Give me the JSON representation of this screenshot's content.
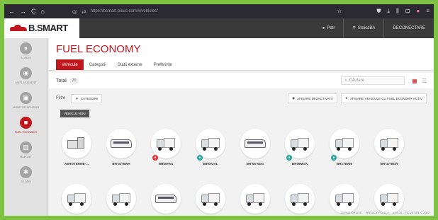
{
  "browser": {
    "url": "https://bsmart.picus.com/#/vehicles/",
    "nav_back": "←",
    "nav_forward": "→",
    "nav_reload": "C",
    "nav_home": "⌂",
    "shield": "◎",
    "lock": "🔒",
    "perm": "⇄",
    "star": "☆",
    "icons_right": [
      "⛊",
      "⤓",
      "⫼",
      "⊡",
      "●",
      "≡"
    ]
  },
  "header": {
    "brand": "B.SMART",
    "user_label": "Petr",
    "company_label": "StoicaBA",
    "logout_label": "DECONECTARE"
  },
  "sidebar": {
    "items": [
      {
        "label": "ȘOFERI",
        "icon": "user"
      },
      {
        "label": "AMPLASAMENT",
        "icon": "pin"
      },
      {
        "label": "MONITOR SENZORI",
        "icon": "sensor"
      },
      {
        "label": "FUEL ECONOMY",
        "icon": "truck",
        "active": true
      },
      {
        "label": "RAPORT",
        "icon": "chart"
      },
      {
        "label": "SETĂRI",
        "icon": "gear"
      }
    ]
  },
  "main": {
    "title": "FUEL ECONOMY",
    "tabs": [
      {
        "label": "Vehicule",
        "active": true
      },
      {
        "label": "Categorii"
      },
      {
        "label": "Stații externe"
      },
      {
        "label": "Preferințe"
      }
    ],
    "total_label": "Total",
    "total_count": "20",
    "search_placeholder": "Căutare",
    "filter_label": "Filtre",
    "categories_button": "CATEGORII",
    "show_deactivated_button": "AFIȘARE DEZACTIVATĂ",
    "show_active_fe_button": "AFIȘARE VEHICULE CU FUEL ECONOMY ACTIV",
    "new_vehicle_button": "VEHICUL NOU"
  },
  "vehicles_row1": [
    {
      "plate": "AEROTERME-...",
      "kind": "machine",
      "badge": null
    },
    {
      "plate": "BH-31-BWH",
      "kind": "bus",
      "badge": null
    },
    {
      "plate": "BH40FAS",
      "kind": "truck",
      "badge": "red"
    },
    {
      "plate": "B80AUVL",
      "kind": "truck",
      "badge": "teal"
    },
    {
      "plate": "BR-05-XDG",
      "kind": "bus",
      "badge": null
    },
    {
      "plate": "BR09MGA",
      "kind": "truck",
      "badge": "teal"
    },
    {
      "plate": "BR17BAW",
      "kind": "truck",
      "badge": "teal"
    },
    {
      "plate": "BR-17-BCH",
      "kind": "truck",
      "badge": null
    }
  ],
  "vehicles_row2": [
    {
      "kind": "truck"
    },
    {
      "kind": "truck"
    },
    {
      "kind": "bus"
    },
    {
      "kind": "truck"
    },
    {
      "kind": "truck"
    },
    {
      "kind": "truck"
    },
    {
      "kind": "truck"
    },
    {
      "kind": "truck"
    }
  ],
  "footer": {
    "terms": "TERMS OF USE",
    "privacy": "PRIVACY POLICY",
    "version": "V1.9.16 - PICUS SRL © 2022"
  },
  "colors": {
    "accent": "#c0161e",
    "header_dark": "#3a3a3a",
    "badge_red": "#e4393b",
    "badge_teal": "#2ea6a0"
  }
}
